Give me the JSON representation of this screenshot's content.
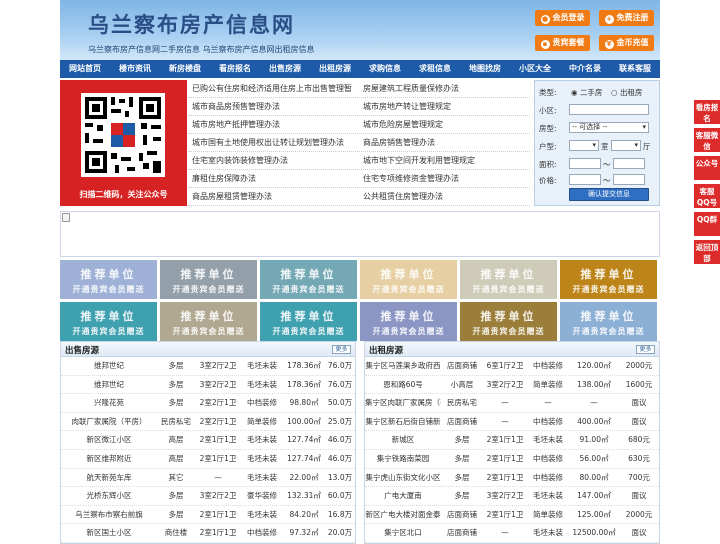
{
  "header": {
    "title": "乌兰察布房产信息网",
    "subtitle": "乌兰察布房产信息网二手房信息    乌兰察布房产信息网出租房信息",
    "btn_login": "会员登录",
    "btn_register": "免费注册",
    "btn_package": "贵宾套餐",
    "btn_recharge": "金币充值"
  },
  "nav": [
    "网站首页",
    "楼市资讯",
    "新房楼盘",
    "看房报名",
    "出售房源",
    "出租房源",
    "求购信息",
    "求租信息",
    "地图找房",
    "小区大全",
    "中介名录",
    "联系客服"
  ],
  "qr": {
    "caption": "扫描二维码，关注公众号"
  },
  "policy_links": [
    [
      "已购公有住房和经济适用住房上市出售管理暂",
      "房屋建筑工程质量保修办法"
    ],
    [
      "城市商品房预售管理办法",
      "城市房地产转让管理规定"
    ],
    [
      "城市房地产抵押管理办法",
      "城市危险房屋管理规定"
    ],
    [
      "城市国有土地使用权出让转让规划管理办法",
      "商品房销售管理办法"
    ],
    [
      "住宅室内装饰装修管理办法",
      "城市地下空间开发利用管理规定"
    ],
    [
      "廉租住房保障办法",
      "住宅专项维修资金管理办法"
    ],
    [
      "商品房屋租赁管理办法",
      "公共租赁住房管理办法"
    ]
  ],
  "search": {
    "type_label": "类型:",
    "opt_sale": "二手房",
    "opt_rent": "出租房",
    "community_label": "小区:",
    "housetype_label": "房型:",
    "housetype_value": "-- 可选择 --",
    "layout_label": "户型:",
    "room_unit": "室",
    "hall_unit": "厅",
    "area_label": "面积:",
    "price_label": "价格:",
    "range_sep": "～",
    "submit": "确认提交信息"
  },
  "ads": {
    "line1": "推荐单位",
    "line2": "开通贵宾会员赠送",
    "colors": [
      "#9fb1d6",
      "#93a0aa",
      "#74a8b4",
      "#e6cfa2",
      "#cfcbb9",
      "#bd8519",
      "#3fa1b0",
      "#b0a890",
      "#3fa1b0",
      "#8b96c4",
      "#9a7e3a",
      "#8cafd5"
    ]
  },
  "sale": {
    "title": "出售房源",
    "more": "更多",
    "rows": [
      [
        "维邦世纪",
        "多层",
        "3室2厅2卫",
        "毛坯未装",
        "178.36㎡",
        "76.0万"
      ],
      [
        "维邦世纪",
        "多层",
        "3室2厅2卫",
        "毛坯未装",
        "178.36㎡",
        "76.0万"
      ],
      [
        "兴隆花苑",
        "多层",
        "2室2厅1卫",
        "中档装修",
        "98.80㎡",
        "50.0万"
      ],
      [
        "肉联厂家属院（平房）",
        "民房私宅",
        "2室2厅1卫",
        "简单装修",
        "100.00㎡",
        "25.0万"
      ],
      [
        "新区微江小区",
        "高层",
        "2室1厅1卫",
        "毛坯未装",
        "127.74㎡",
        "46.0万"
      ],
      [
        "新区维邦附近",
        "高层",
        "2室1厅1卫",
        "毛坯未装",
        "127.74㎡",
        "46.0万"
      ],
      [
        "航天新苑车库",
        "其它",
        "—",
        "毛坯未装",
        "22.00㎡",
        "13.0万"
      ],
      [
        "光桥东辉小区",
        "多层",
        "3室2厅2卫",
        "豪华装修",
        "132.31㎡",
        "60.0万"
      ],
      [
        "乌兰察布市察右前旗",
        "多层",
        "2室1厅1卫",
        "毛坯未装",
        "84.20㎡",
        "16.8万"
      ],
      [
        "新区国土小区",
        "商住楼",
        "2室1厅1卫",
        "中档装修",
        "97.32㎡",
        "20.0万"
      ]
    ]
  },
  "rent": {
    "title": "出租房源",
    "more": "更多",
    "rows": [
      [
        "集宁区马莲渠乡政府西",
        "店面商铺",
        "6室1厅2卫",
        "中档装修",
        "120.00㎡",
        "2000元"
      ],
      [
        "恩和路60号",
        "小高层",
        "3室2厅2卫",
        "简单装修",
        "138.00㎡",
        "1600元"
      ],
      [
        "集宁区肉联厂家属房（平",
        "民房私宅",
        "—",
        "—",
        "—",
        "面议"
      ],
      [
        "集宁区新石后街自铺新",
        "店面商铺",
        "—",
        "中档装修",
        "400.00㎡",
        "面议"
      ],
      [
        "新城区",
        "多层",
        "2室1厅1卫",
        "毛坯未装",
        "91.00㎡",
        "680元"
      ],
      [
        "集宁铁路南菜园",
        "多层",
        "2室1厅1卫",
        "中档装修",
        "56.00㎡",
        "630元"
      ],
      [
        "集宁虎山东街文化小区",
        "多层",
        "2室1厅1卫",
        "中档装修",
        "80.00㎡",
        "700元"
      ],
      [
        "广电大厦南",
        "多层",
        "3室2厅2卫",
        "毛坯未装",
        "147.00㎡",
        "面议"
      ],
      [
        "新区广电大楼对面金泰",
        "店面商铺",
        "2室1厅1卫",
        "简单装修",
        "125.00㎡",
        "2000元"
      ],
      [
        "集宁区北口",
        "店面商铺",
        "—",
        "毛坯未装",
        "12500.00㎡",
        "面议"
      ]
    ]
  },
  "sidebar": [
    "看房报名",
    "客服微信",
    "公众号",
    "客服QQ号",
    "QQ群",
    "返回顶部"
  ]
}
